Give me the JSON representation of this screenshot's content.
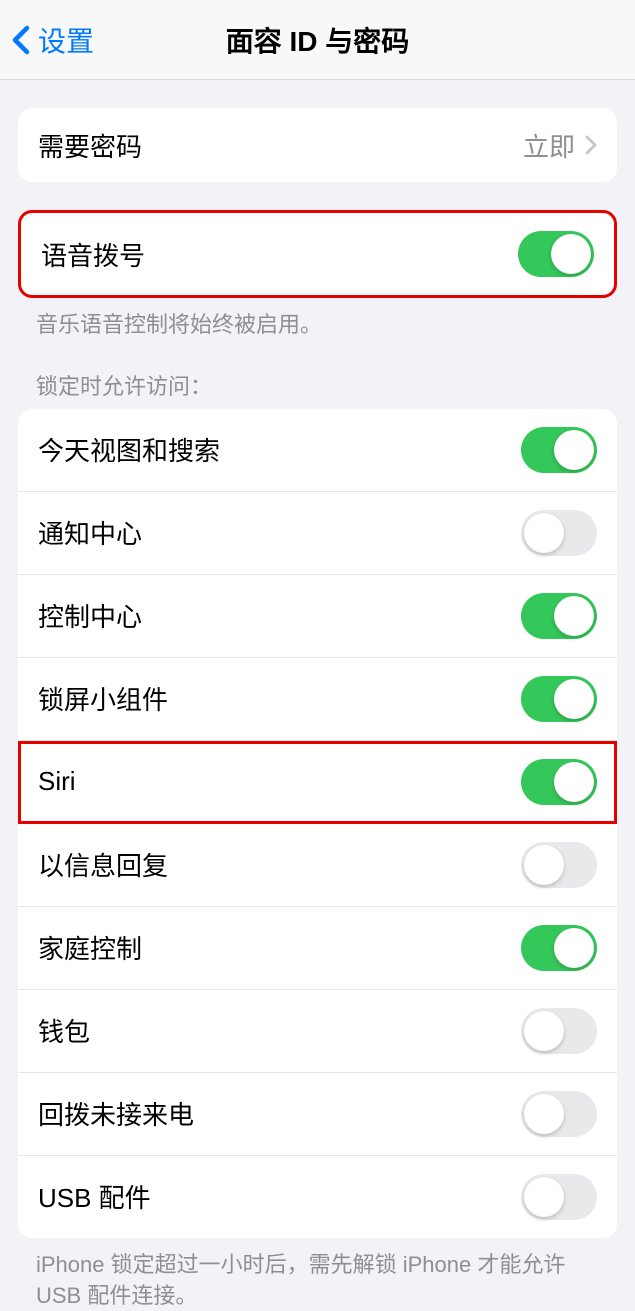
{
  "nav": {
    "back_label": "设置",
    "title": "面容 ID 与密码"
  },
  "require_passcode": {
    "label": "需要密码",
    "value": "立即"
  },
  "voice_dial": {
    "label": "语音拨号",
    "footer": "音乐语音控制将始终被启用。",
    "on": true
  },
  "allow_access_header": "锁定时允许访问：",
  "allow_access": {
    "items": [
      {
        "label": "今天视图和搜索",
        "on": true,
        "highlight": false
      },
      {
        "label": "通知中心",
        "on": false,
        "highlight": false
      },
      {
        "label": "控制中心",
        "on": true,
        "highlight": false
      },
      {
        "label": "锁屏小组件",
        "on": true,
        "highlight": false
      },
      {
        "label": "Siri",
        "on": true,
        "highlight": true
      },
      {
        "label": "以信息回复",
        "on": false,
        "highlight": false
      },
      {
        "label": "家庭控制",
        "on": true,
        "highlight": false
      },
      {
        "label": "钱包",
        "on": false,
        "highlight": false
      },
      {
        "label": "回拨未接来电",
        "on": false,
        "highlight": false
      },
      {
        "label": "USB 配件",
        "on": false,
        "highlight": false
      }
    ],
    "footer": "iPhone 锁定超过一小时后，需先解锁 iPhone 才能允许 USB 配件连接。"
  }
}
